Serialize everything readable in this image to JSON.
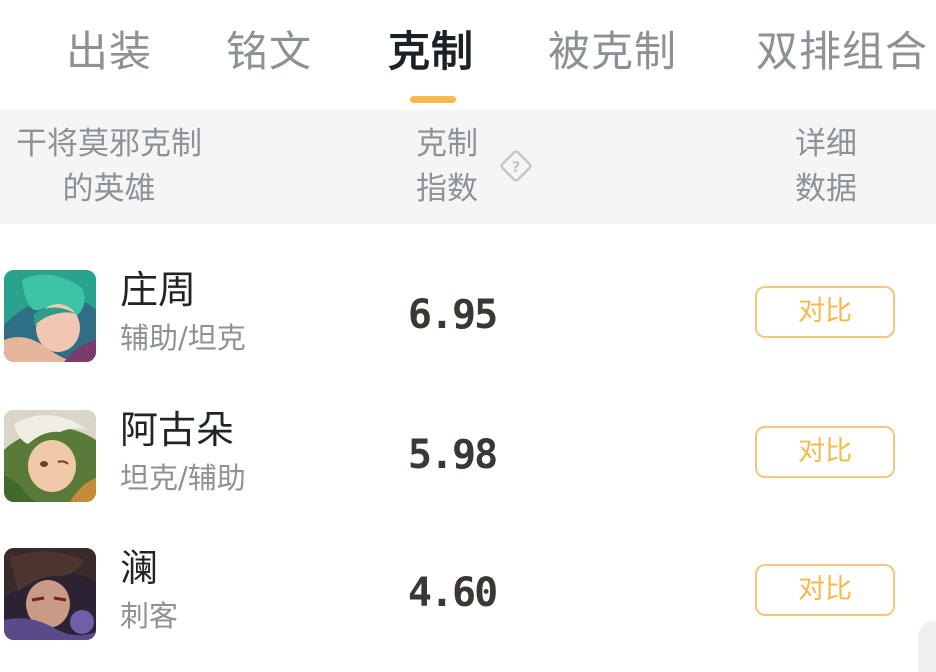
{
  "tabs": [
    {
      "label": "出装",
      "active": false
    },
    {
      "label": "铭文",
      "active": false
    },
    {
      "label": "克制",
      "active": true
    },
    {
      "label": "被克制",
      "active": false
    },
    {
      "label": "双排组合",
      "active": false
    }
  ],
  "header": {
    "col_hero": "干将莫邪克制 的英雄",
    "col_hero_line1": "干将莫邪克制",
    "col_hero_line2": "的英雄",
    "col_index_line1": "克制",
    "col_index_line2": "指数",
    "col_detail_line1": "详细",
    "col_detail_line2": "数据",
    "help_icon": "question-diamond-icon"
  },
  "rows": [
    {
      "name": "庄周",
      "roles": "辅助/坦克",
      "score": "6.95",
      "action": "对比"
    },
    {
      "name": "阿古朵",
      "roles": "坦克/辅助",
      "score": "5.98",
      "action": "对比"
    },
    {
      "name": "澜",
      "roles": "刺客",
      "score": "4.60",
      "action": "对比"
    }
  ],
  "colors": {
    "accent": "#f5b94d",
    "header_bg": "#f4f5f7",
    "active_text": "#1c2126",
    "muted_text": "#8c9196"
  }
}
